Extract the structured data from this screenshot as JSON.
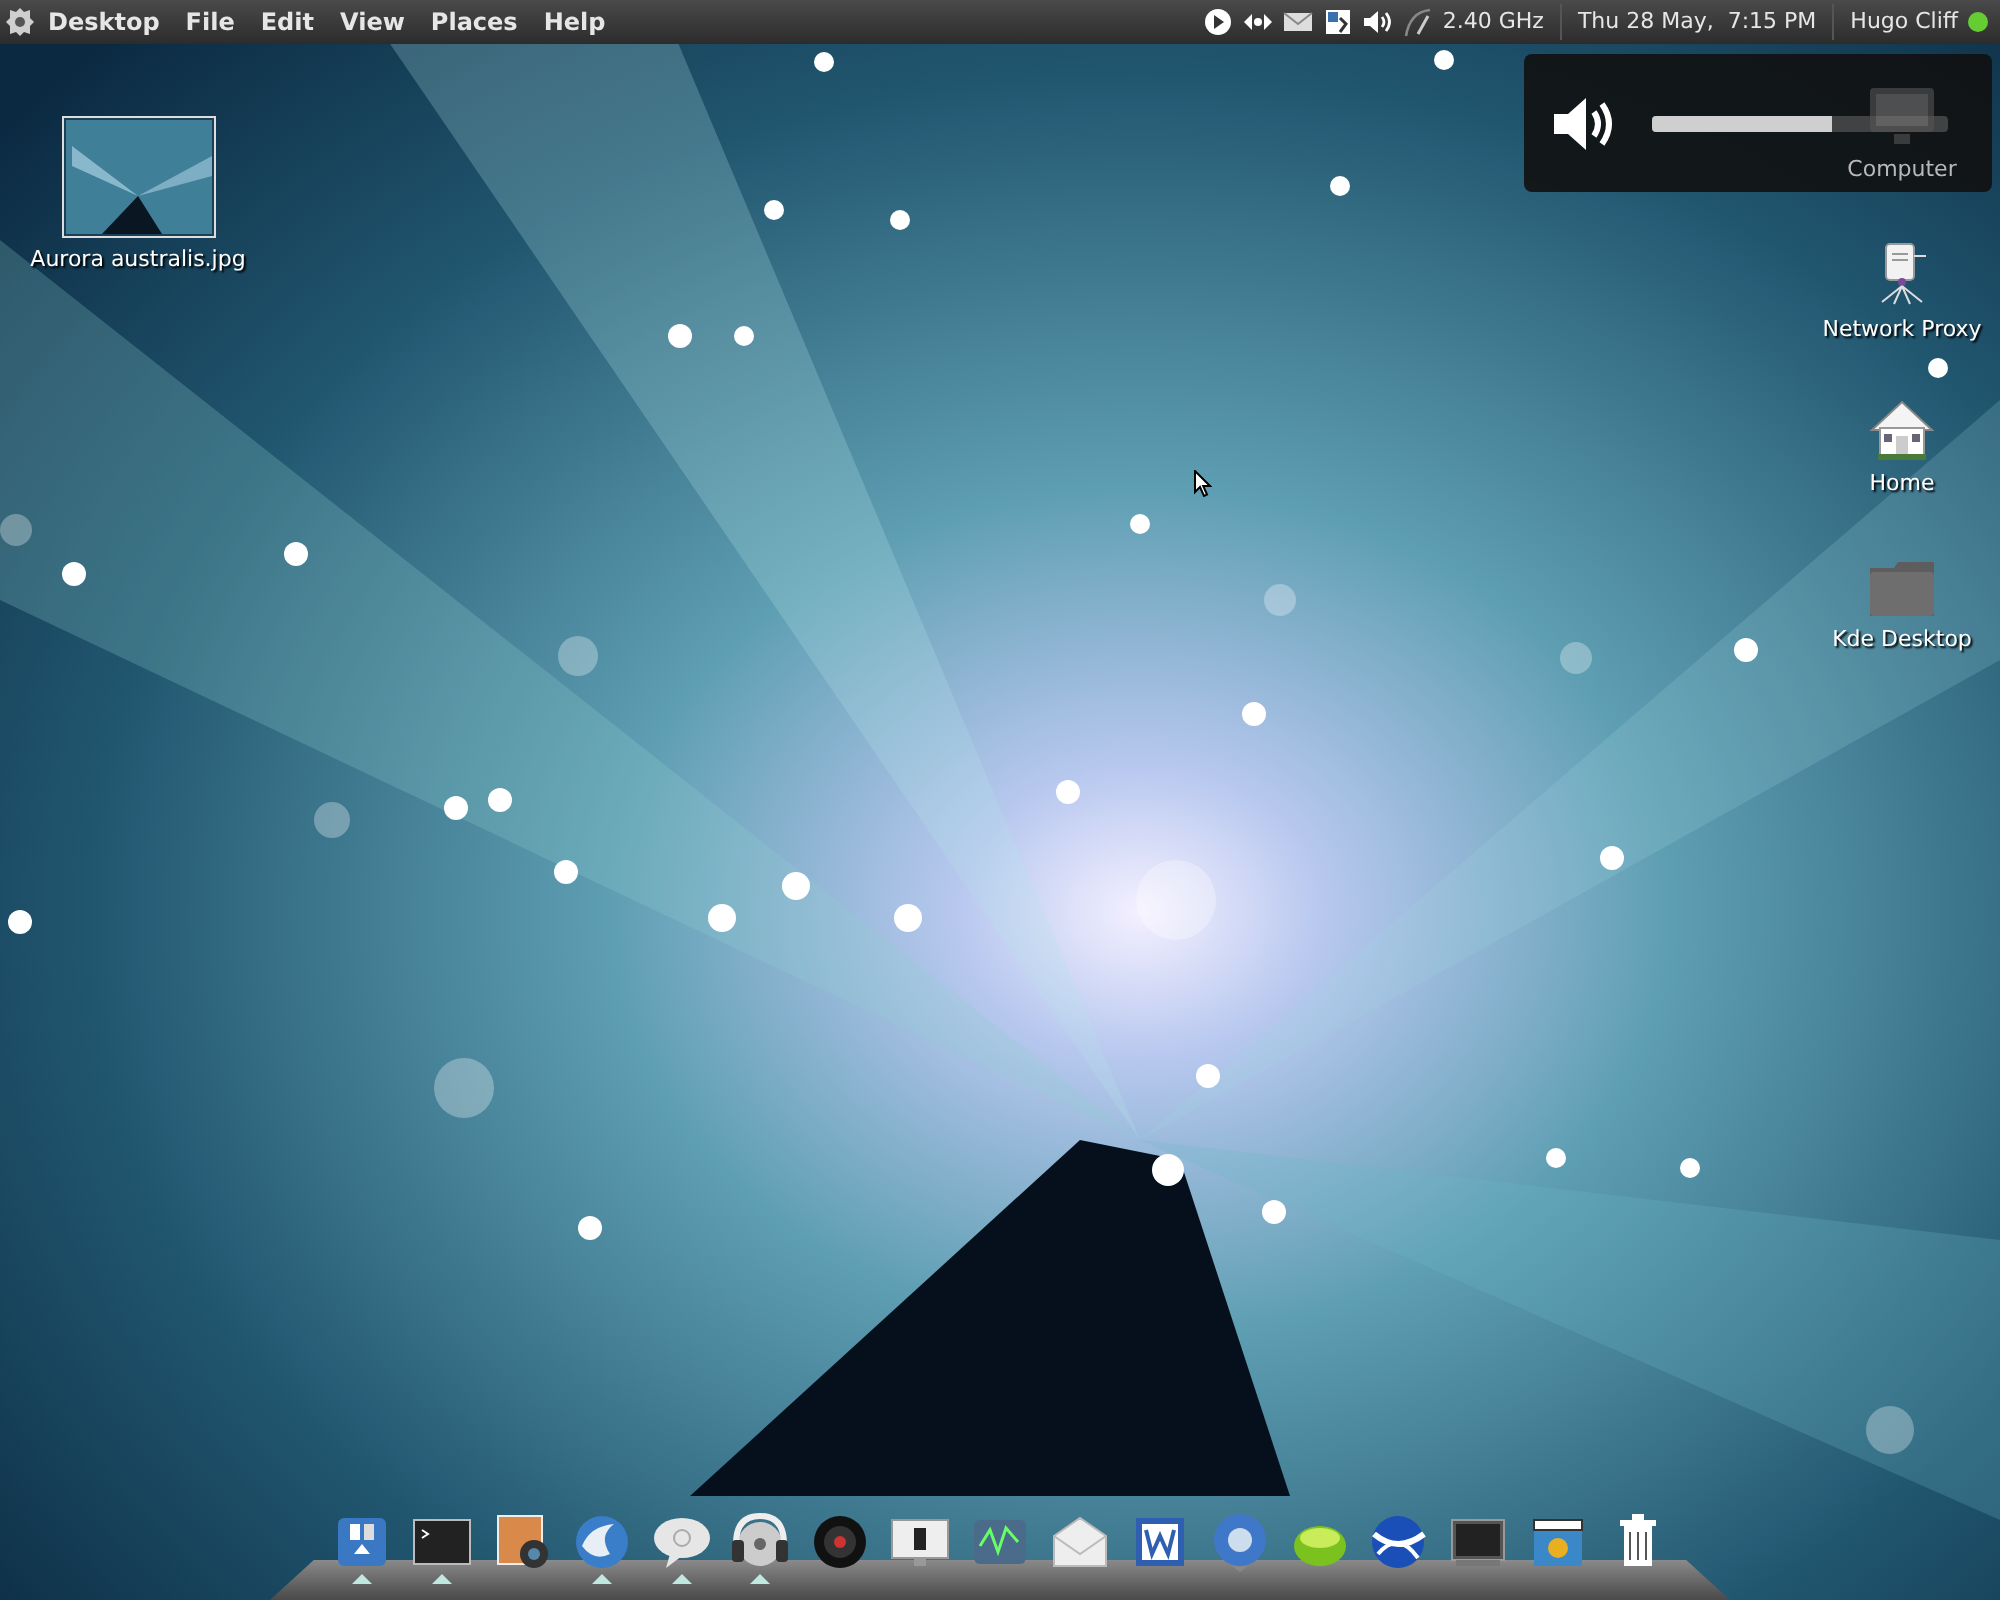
{
  "top_panel": {
    "menus": [
      {
        "label": "Desktop",
        "kind": "app"
      },
      {
        "label": "File",
        "kind": "menu"
      },
      {
        "label": "Edit",
        "kind": "menu"
      },
      {
        "label": "View",
        "kind": "menu"
      },
      {
        "label": "Places",
        "kind": "menu"
      },
      {
        "label": "Help",
        "kind": "menu"
      }
    ],
    "tray": [
      {
        "kind": "play"
      },
      {
        "kind": "network"
      },
      {
        "kind": "mail"
      },
      {
        "kind": "update"
      },
      {
        "kind": "volume"
      },
      {
        "kind": "gauge"
      }
    ],
    "cpu_frequency": "2.40 GHz",
    "clock": "Thu 28 May,  7:15 PM",
    "user": {
      "name": "Hugo Cliff",
      "color": "#66cc33"
    }
  },
  "volume_popup": {
    "level": 0.61
  },
  "left_icons": [
    {
      "label": "Aurora australis.jpg",
      "kind": "image"
    }
  ],
  "right_icons": [
    {
      "label": "Computer",
      "kind": "computer"
    },
    {
      "label": "Network Proxy",
      "kind": "proxy"
    },
    {
      "label": "Home",
      "kind": "home"
    },
    {
      "label": "Kde Desktop",
      "kind": "folder"
    }
  ],
  "dock": [
    {
      "kind": "files",
      "running": true
    },
    {
      "kind": "terminal",
      "running": true
    },
    {
      "kind": "photos",
      "running": false
    },
    {
      "kind": "browser",
      "running": true
    },
    {
      "kind": "chat",
      "running": true
    },
    {
      "kind": "headphones",
      "running": true
    },
    {
      "kind": "camera",
      "running": false
    },
    {
      "kind": "monitor",
      "running": false
    },
    {
      "kind": "sysmon",
      "running": false
    },
    {
      "kind": "mail",
      "running": false
    },
    {
      "kind": "document",
      "running": false
    },
    {
      "kind": "globe-blue",
      "running": false
    },
    {
      "kind": "lime",
      "running": false
    },
    {
      "kind": "globe",
      "running": false
    },
    {
      "kind": "console",
      "running": false
    },
    {
      "kind": "video",
      "running": false
    },
    {
      "kind": "trash",
      "running": false
    }
  ]
}
